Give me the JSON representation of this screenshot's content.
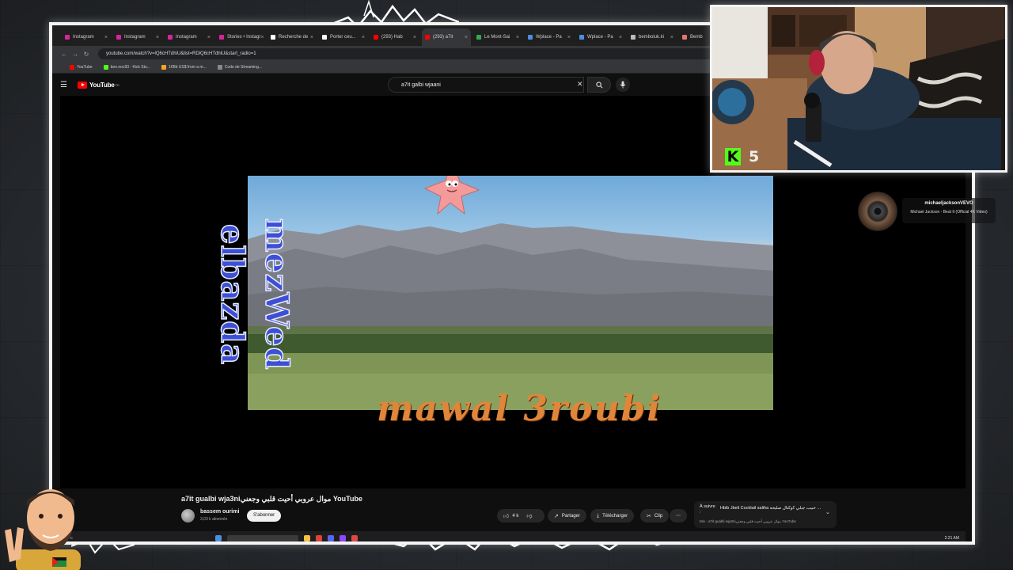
{
  "browser": {
    "tabs": [
      {
        "label": "Instagram",
        "fav": "#d6249f"
      },
      {
        "label": "Instagram",
        "fav": "#d6249f"
      },
      {
        "label": "Instagram",
        "fav": "#d6249f"
      },
      {
        "label": "Stories • Instagr",
        "fav": "#d6249f"
      },
      {
        "label": "Recherche de",
        "fav": "#ffffff"
      },
      {
        "label": "Porter ceu...",
        "fav": "#ffffff"
      },
      {
        "label": "(293) Hab",
        "fav": "#ff0000"
      },
      {
        "label": "(293) a7it",
        "fav": "#ff0000"
      },
      {
        "label": "Le Mont-Sai",
        "fav": "#34a853"
      },
      {
        "label": "Wplace - Pa",
        "fav": "#4a90e2"
      },
      {
        "label": "Wplace - Pa",
        "fav": "#4a90e2"
      },
      {
        "label": "bemboluk.ki",
        "fav": "#bbbbbb"
      },
      {
        "label": "Bemb",
        "fav": "#e57373"
      }
    ],
    "active_tab_index": 7,
    "url": "youtube.com/watch?v=lQ6cHTdhiU&list=RDlQ6cHTdhiU&start_radio=1",
    "bookmarks": [
      {
        "label": "YouTube",
        "fav": "#ff0000"
      },
      {
        "label": "ben.noc93 - Kick Stu...",
        "fav": "#53fc18"
      },
      {
        "label": "1€Bit US$ from a m...",
        "fav": "#f5a623"
      },
      {
        "label": "Code de Streaming...",
        "fav": "#888888"
      }
    ]
  },
  "youtube": {
    "logo": "YouTube",
    "logo_region": "FR",
    "search_value": "a7it galbi wjaani"
  },
  "video": {
    "vertical_caption": "mezWed elbazda",
    "overlay_caption": "mawal 3roubi"
  },
  "info": {
    "title": "a7it gualbi wja3niموال عروبي أحيت قلبي وجعني YouTube",
    "channel": "bassem ourimi",
    "subscribers": "3,03 k abonnés",
    "subscribe_label": "S'abonner",
    "like_count": "4 k",
    "share_label": "Partager",
    "download_label": "Télécharger",
    "clip_label": "Clip",
    "more_label": "⋯",
    "up_next_label": "À suivre :",
    "up_next_title": "Hbib Jbeli Cocktail saliha حبيب جبلي كوكتال صليحة ...",
    "up_next_sub": "Mix - a7it gualbi wja3niموال عروبي أحيت قلبي وجعني YouTube"
  },
  "taskbar": {
    "weather": "18°C",
    "time": "2:21 AM"
  },
  "webcam": {
    "platform": "K",
    "viewer_count": "5"
  },
  "now_playing": {
    "artist": "michaeljacksonVEVO",
    "track": "Michael Jackson - Beat It (Official 4K Video)"
  },
  "colors": {
    "frame_border": "#f4f4f4",
    "kick_green": "#53fc18",
    "youtube_red": "#ff0000",
    "caption_orange": "#e0863a",
    "vertical_caption_blue": "#3d4fd6"
  }
}
